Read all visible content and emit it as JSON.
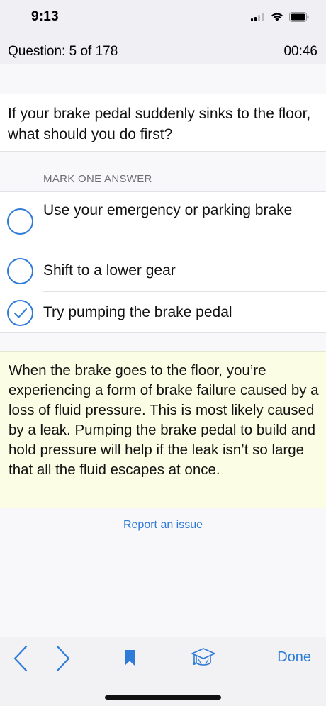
{
  "status_bar": {
    "time": "9:13"
  },
  "header": {
    "question_counter": "Question: 5 of 178",
    "timer": "00:46"
  },
  "question": {
    "text": "If your brake pedal suddenly sinks to the floor, what should you do first?"
  },
  "answers": {
    "section_label": "MARK ONE ANSWER",
    "options": [
      {
        "label": "Use your emergency or parking brake",
        "selected": false
      },
      {
        "label": "Shift to a lower gear",
        "selected": false
      },
      {
        "label": "Try pumping the brake pedal",
        "selected": true
      }
    ]
  },
  "explanation": {
    "text": "When the brake goes to the floor, you’re experiencing a form of brake failure caused by a loss of fluid pressure. This is most likely caused by a leak. Pumping the brake pedal to build and hold pressure will help if the leak isn’t so large that all the fluid escapes at once."
  },
  "report_link": "Report an issue",
  "toolbar": {
    "done_label": "Done",
    "icons": [
      "chevron-left-icon",
      "chevron-right-icon",
      "bookmark-icon",
      "graduation-cap-icon"
    ]
  },
  "colors": {
    "accent": "#2e7bd8",
    "explanation_bg": "#fcfde5"
  }
}
